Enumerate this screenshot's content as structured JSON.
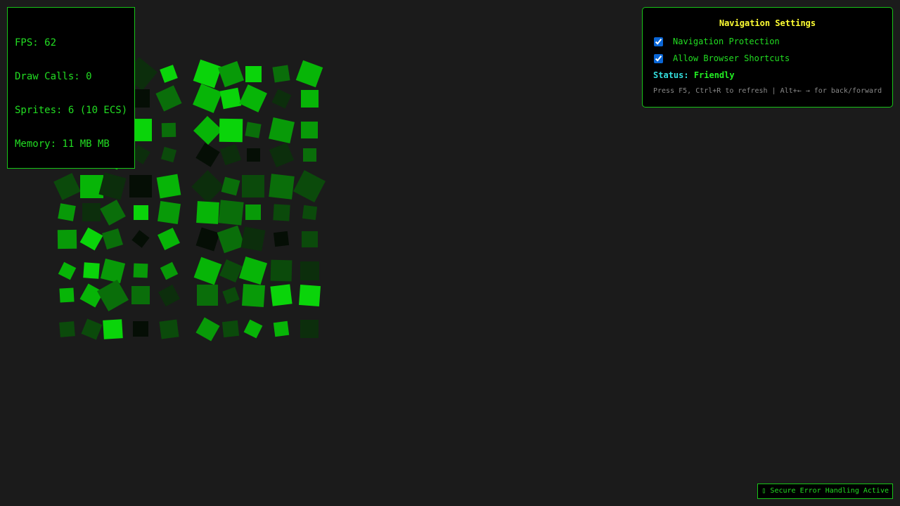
{
  "stats": {
    "fps": "FPS: 62",
    "draw_calls": "Draw Calls: 0",
    "sprites": "Sprites: 6 (10 ECS)",
    "memory": "Memory: 11 MB MB"
  },
  "settings": {
    "title": "Navigation Settings",
    "options": [
      {
        "label": "Navigation Protection",
        "checked": true
      },
      {
        "label": "Allow Browser Shortcuts",
        "checked": true
      }
    ],
    "status_label": "Status:",
    "status_value": "Friendly",
    "hint": "Press F5, Ctrl+R to refresh | Alt+← → for back/forward"
  },
  "badge": {
    "icon": "shield-icon",
    "text": "Secure Error Handling Active"
  },
  "colors": {
    "background": "#1b1b1b",
    "accent": "#22dd22",
    "title": "#ffff33",
    "status_label": "#33dddd",
    "sprite_palette": [
      "#0ad40a",
      "#089a08",
      "#0a6e0a",
      "#0b4a0b",
      "#0c2e0c",
      "#050e05",
      "#07b507"
    ]
  }
}
